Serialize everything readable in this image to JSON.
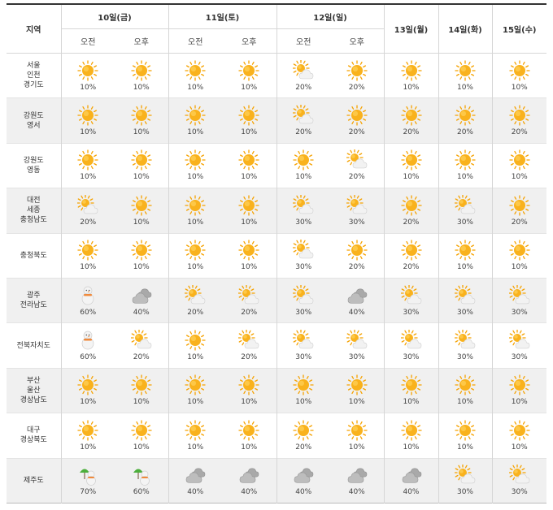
{
  "header": {
    "region_label": "지역",
    "days": [
      {
        "label": "10일(금)",
        "periods": [
          "오전",
          "오후"
        ]
      },
      {
        "label": "11일(토)",
        "periods": [
          "오전",
          "오후"
        ]
      },
      {
        "label": "12일(일)",
        "periods": [
          "오전",
          "오후"
        ]
      },
      {
        "label": "13일(월)",
        "periods": []
      },
      {
        "label": "14일(화)",
        "periods": []
      },
      {
        "label": "15일(수)",
        "periods": []
      }
    ]
  },
  "icons": {
    "sunny": "sun-icon",
    "partly": "partly-cloudy-icon",
    "cloudy": "cloudy-icon",
    "snow": "snow-icon",
    "rain": "rain-umbrella-icon"
  },
  "colors": {
    "sun": "#f9b21d",
    "sun_ray": "#f5a200",
    "cloud": "#e4e4e4",
    "cloud_dark": "#a9a9a9",
    "umbrella": "#4caf3c",
    "row_alt": "#f0f0f0"
  },
  "rows": [
    {
      "region": "서울\n인천\n경기도",
      "cells": [
        {
          "icon": "sunny",
          "pct": "10%"
        },
        {
          "icon": "sunny",
          "pct": "10%"
        },
        {
          "icon": "sunny",
          "pct": "10%"
        },
        {
          "icon": "sunny",
          "pct": "10%"
        },
        {
          "icon": "partly",
          "pct": "20%"
        },
        {
          "icon": "sunny",
          "pct": "20%"
        },
        {
          "icon": "sunny",
          "pct": "10%"
        },
        {
          "icon": "sunny",
          "pct": "10%"
        },
        {
          "icon": "sunny",
          "pct": "10%"
        }
      ]
    },
    {
      "region": "강원도\n영서",
      "cells": [
        {
          "icon": "sunny",
          "pct": "10%"
        },
        {
          "icon": "sunny",
          "pct": "10%"
        },
        {
          "icon": "sunny",
          "pct": "10%"
        },
        {
          "icon": "sunny",
          "pct": "10%"
        },
        {
          "icon": "partly",
          "pct": "20%"
        },
        {
          "icon": "sunny",
          "pct": "20%"
        },
        {
          "icon": "sunny",
          "pct": "20%"
        },
        {
          "icon": "sunny",
          "pct": "20%"
        },
        {
          "icon": "sunny",
          "pct": "20%"
        }
      ]
    },
    {
      "region": "강원도\n영동",
      "cells": [
        {
          "icon": "sunny",
          "pct": "10%"
        },
        {
          "icon": "sunny",
          "pct": "10%"
        },
        {
          "icon": "sunny",
          "pct": "10%"
        },
        {
          "icon": "sunny",
          "pct": "10%"
        },
        {
          "icon": "sunny",
          "pct": "10%"
        },
        {
          "icon": "partly",
          "pct": "20%"
        },
        {
          "icon": "sunny",
          "pct": "10%"
        },
        {
          "icon": "sunny",
          "pct": "10%"
        },
        {
          "icon": "sunny",
          "pct": "10%"
        }
      ]
    },
    {
      "region": "대전\n세종\n충청남도",
      "cells": [
        {
          "icon": "partly",
          "pct": "20%"
        },
        {
          "icon": "sunny",
          "pct": "10%"
        },
        {
          "icon": "sunny",
          "pct": "10%"
        },
        {
          "icon": "sunny",
          "pct": "10%"
        },
        {
          "icon": "partly",
          "pct": "30%"
        },
        {
          "icon": "partly",
          "pct": "30%"
        },
        {
          "icon": "sunny",
          "pct": "20%"
        },
        {
          "icon": "partly",
          "pct": "30%"
        },
        {
          "icon": "sunny",
          "pct": "20%"
        }
      ]
    },
    {
      "region": "충청북도",
      "cells": [
        {
          "icon": "sunny",
          "pct": "10%"
        },
        {
          "icon": "sunny",
          "pct": "10%"
        },
        {
          "icon": "sunny",
          "pct": "10%"
        },
        {
          "icon": "sunny",
          "pct": "10%"
        },
        {
          "icon": "partly",
          "pct": "30%"
        },
        {
          "icon": "sunny",
          "pct": "20%"
        },
        {
          "icon": "sunny",
          "pct": "20%"
        },
        {
          "icon": "sunny",
          "pct": "10%"
        },
        {
          "icon": "sunny",
          "pct": "10%"
        }
      ]
    },
    {
      "region": "광주\n전라남도",
      "cells": [
        {
          "icon": "snow",
          "pct": "60%"
        },
        {
          "icon": "cloudy",
          "pct": "40%"
        },
        {
          "icon": "partly",
          "pct": "20%"
        },
        {
          "icon": "partly",
          "pct": "20%"
        },
        {
          "icon": "partly",
          "pct": "30%"
        },
        {
          "icon": "cloudy",
          "pct": "40%"
        },
        {
          "icon": "partly",
          "pct": "30%"
        },
        {
          "icon": "partly",
          "pct": "30%"
        },
        {
          "icon": "partly",
          "pct": "30%"
        }
      ]
    },
    {
      "region": "전북자치도",
      "cells": [
        {
          "icon": "snow",
          "pct": "60%"
        },
        {
          "icon": "partly",
          "pct": "20%"
        },
        {
          "icon": "sunny",
          "pct": "10%"
        },
        {
          "icon": "partly",
          "pct": "20%"
        },
        {
          "icon": "partly",
          "pct": "30%"
        },
        {
          "icon": "partly",
          "pct": "30%"
        },
        {
          "icon": "partly",
          "pct": "30%"
        },
        {
          "icon": "partly",
          "pct": "30%"
        },
        {
          "icon": "partly",
          "pct": "30%"
        }
      ]
    },
    {
      "region": "부산\n울산\n경상남도",
      "cells": [
        {
          "icon": "sunny",
          "pct": "10%"
        },
        {
          "icon": "sunny",
          "pct": "10%"
        },
        {
          "icon": "sunny",
          "pct": "10%"
        },
        {
          "icon": "sunny",
          "pct": "10%"
        },
        {
          "icon": "sunny",
          "pct": "10%"
        },
        {
          "icon": "sunny",
          "pct": "10%"
        },
        {
          "icon": "sunny",
          "pct": "10%"
        },
        {
          "icon": "sunny",
          "pct": "10%"
        },
        {
          "icon": "sunny",
          "pct": "10%"
        }
      ]
    },
    {
      "region": "대구\n경상북도",
      "cells": [
        {
          "icon": "sunny",
          "pct": "10%"
        },
        {
          "icon": "sunny",
          "pct": "10%"
        },
        {
          "icon": "sunny",
          "pct": "10%"
        },
        {
          "icon": "sunny",
          "pct": "10%"
        },
        {
          "icon": "sunny",
          "pct": "20%"
        },
        {
          "icon": "sunny",
          "pct": "10%"
        },
        {
          "icon": "sunny",
          "pct": "10%"
        },
        {
          "icon": "sunny",
          "pct": "10%"
        },
        {
          "icon": "sunny",
          "pct": "10%"
        }
      ]
    },
    {
      "region": "제주도",
      "cells": [
        {
          "icon": "rain",
          "pct": "70%"
        },
        {
          "icon": "rain",
          "pct": "60%"
        },
        {
          "icon": "cloudy",
          "pct": "40%"
        },
        {
          "icon": "cloudy",
          "pct": "40%"
        },
        {
          "icon": "cloudy",
          "pct": "40%"
        },
        {
          "icon": "cloudy",
          "pct": "40%"
        },
        {
          "icon": "cloudy",
          "pct": "40%"
        },
        {
          "icon": "partly",
          "pct": "30%"
        },
        {
          "icon": "partly",
          "pct": "30%"
        }
      ]
    }
  ]
}
